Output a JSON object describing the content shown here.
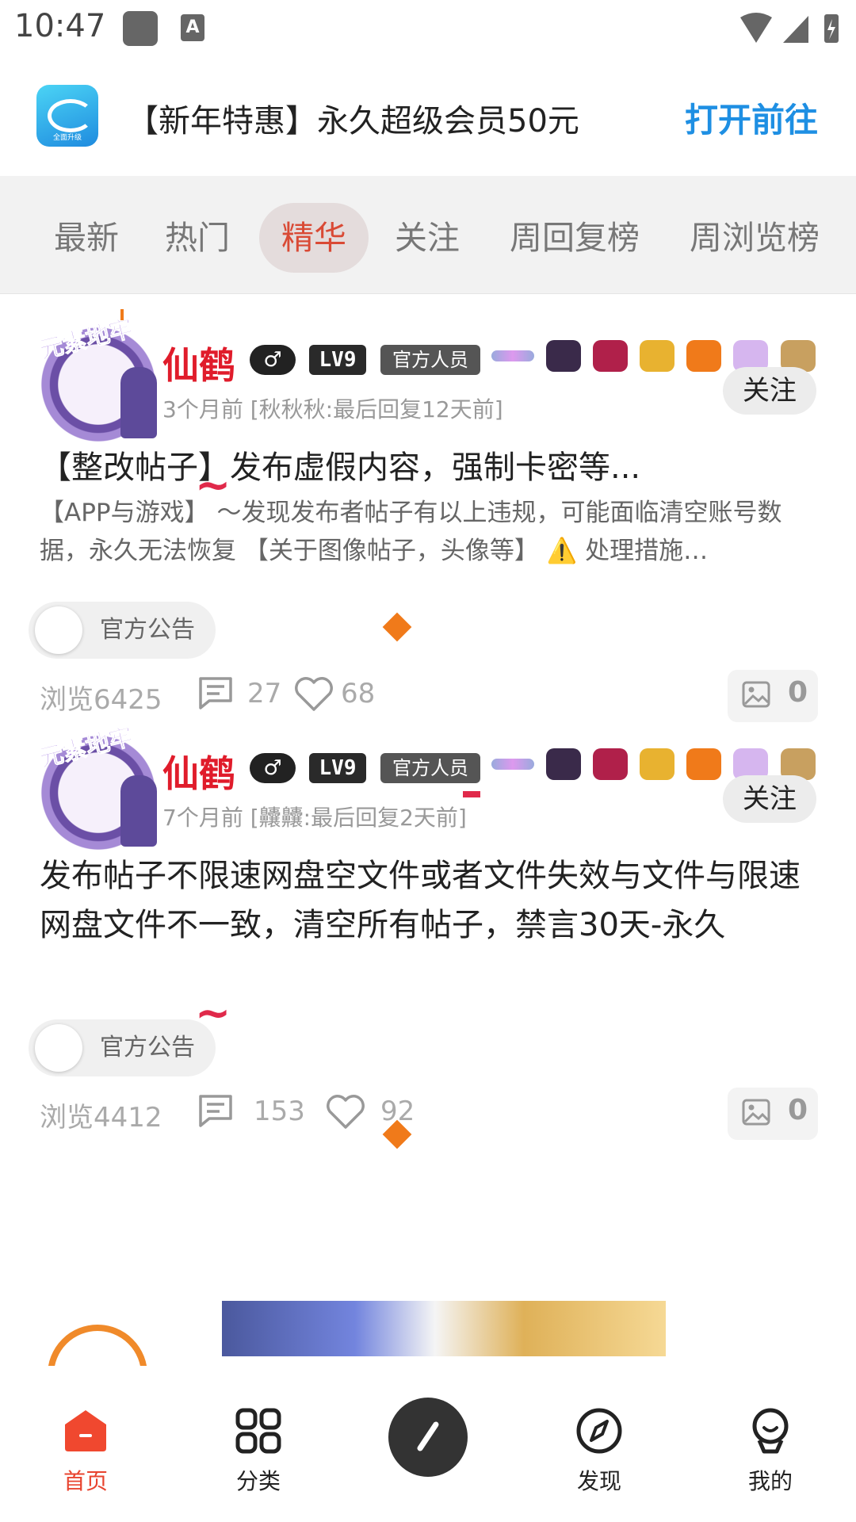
{
  "status_bar": {
    "time": "10:47",
    "keyboard_icon_text": "A"
  },
  "promo": {
    "app_icon": "app-logo-icon",
    "app_icon_caption": "全面升级",
    "text": "【新年特惠】永久超级会员50元",
    "link": "打开前往"
  },
  "tabs": [
    {
      "label": "最新"
    },
    {
      "label": "热门"
    },
    {
      "label": "精华",
      "active": true
    },
    {
      "label": "关注"
    },
    {
      "label": "周回复榜"
    },
    {
      "label": "周浏览榜"
    }
  ],
  "posts": [
    {
      "author": "仙鹤",
      "avatar_frame_text": "元素地牢",
      "gender": "♂",
      "level": "LV9",
      "role": "官方人员",
      "follow": "关注",
      "meta": "3个月前 [秋秋秋:最后回复12天前]",
      "title": "【整改帖子】发布虚假内容，强制卡密等...",
      "summary": "【APP与游戏】 ～发现发布者帖子有以上违规，可能面临清空账号数据，永久无法恢复 【关于图像帖子，头像等】 ⚠️ 处理措施…",
      "tag": "官方公告",
      "views": "浏览6425",
      "comments": "27",
      "likes": "68",
      "images": "0"
    },
    {
      "author": "仙鹤",
      "avatar_frame_text": "元素地牢",
      "gender": "♂",
      "level": "LV9",
      "role": "官方人员",
      "follow": "关注",
      "meta": "7个月前 [齉齉:最后回复2天前]",
      "title": "发布帖子不限速网盘空文件或者文件失效与文件与限速网盘文件不一致，清空所有帖子，禁言30天-永久",
      "tag": "官方公告",
      "views": "浏览4412",
      "comments": "153",
      "likes": "92",
      "images": "0"
    }
  ],
  "bottom_nav": [
    {
      "label": "首页",
      "icon": "home-icon",
      "active": true
    },
    {
      "label": "分类",
      "icon": "grid-icon"
    },
    {
      "label": "",
      "icon": "compose-icon"
    },
    {
      "label": "发现",
      "icon": "compass-icon"
    },
    {
      "label": "我的",
      "icon": "profile-icon"
    }
  ],
  "colors": {
    "accent": "#1e8fe3",
    "active_tab_text": "#d94a35",
    "author_name": "#e01c2b",
    "nav_active": "#e8442f"
  }
}
